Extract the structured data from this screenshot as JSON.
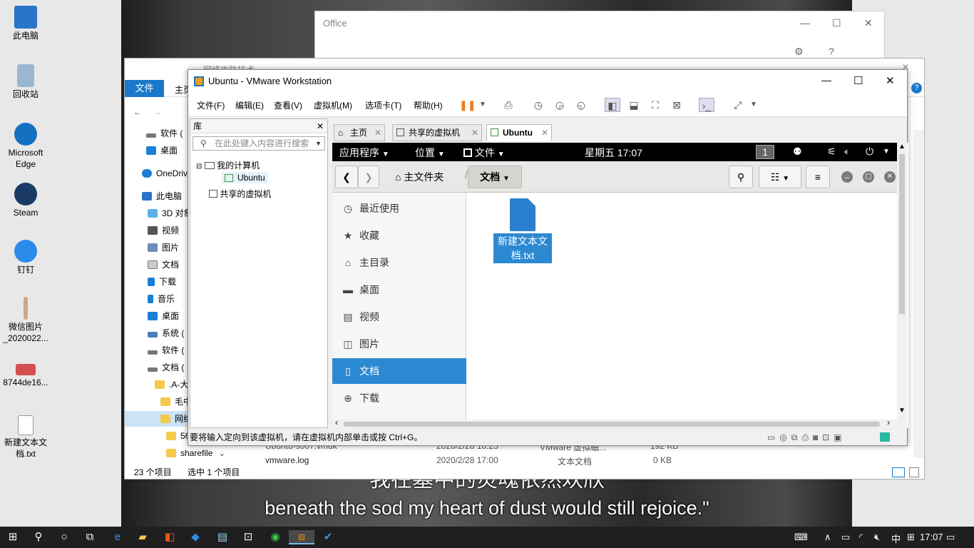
{
  "desktop": {
    "icons": [
      {
        "label": "此电脑",
        "icon": "computer-icon",
        "color": "#2a74c9"
      },
      {
        "label": "回收站",
        "icon": "recycle-bin-icon",
        "color": "#9bb7d0"
      },
      {
        "label": "Microsoft Edge",
        "icon": "edge-icon",
        "color": "#1570c2"
      },
      {
        "label": "Steam",
        "icon": "steam-icon",
        "color": "#1b3a66"
      },
      {
        "label": "钉钉",
        "icon": "dingtalk-icon",
        "color": "#2a8be8"
      },
      {
        "label": "微信图片_2020022...",
        "icon": "image-icon",
        "color": "#c9a88a"
      },
      {
        "label": "8744de16...",
        "icon": "image-icon",
        "color": "#d35050"
      },
      {
        "label": "新建文本文档.txt",
        "icon": "text-file-icon",
        "color": "#ffffff"
      }
    ],
    "subtitle_cn": "我在墓中的灵魂依然欢欣",
    "subtitle_en": "beneath the sod my heart of dust would still rejoice.\""
  },
  "office": {
    "title": "Office"
  },
  "explorer": {
    "title": "网络攻防技术",
    "ribbon_file": "文件",
    "ribbon_home": "主页",
    "sidebar": [
      {
        "label": "软件 (",
        "icon": "drive-icon"
      },
      {
        "label": "桌面",
        "icon": "desktop-folder-icon"
      },
      {
        "label": "OneDriv",
        "icon": "onedrive-icon"
      },
      {
        "label": "此电脑",
        "icon": "computer-icon"
      },
      {
        "label": "3D 对象",
        "icon": "3d-objects-icon"
      },
      {
        "label": "视频",
        "icon": "video-folder-icon"
      },
      {
        "label": "图片",
        "icon": "pictures-folder-icon"
      },
      {
        "label": "文档",
        "icon": "documents-folder-icon"
      },
      {
        "label": "下载",
        "icon": "download-icon"
      },
      {
        "label": "音乐",
        "icon": "music-icon"
      },
      {
        "label": "桌面",
        "icon": "desktop-folder-icon"
      },
      {
        "label": "系统 (",
        "icon": "drive-icon"
      },
      {
        "label": "软件 (",
        "icon": "drive-icon"
      },
      {
        "label": "文档 (",
        "icon": "drive-icon"
      },
      {
        "label": ".A-大",
        "icon": "folder-icon"
      },
      {
        "label": "毛中",
        "icon": "folder-icon"
      },
      {
        "label": "网络",
        "icon": "folder-icon"
      },
      {
        "label": "56",
        "icon": "folder-icon"
      },
      {
        "label": "sharefile",
        "icon": "folder-icon"
      }
    ],
    "files": [
      {
        "name": "Ubuntu-s007.vmdk",
        "date": "2020/2/28 16:23",
        "type": "VMware 虚拟磁...",
        "size": "192 KB"
      },
      {
        "name": "vmware.log",
        "date": "2020/2/28 17:00",
        "type": "文本文档",
        "size": "0 KB"
      }
    ],
    "status_count": "23 个项目",
    "status_selected": "选中 1 个项目"
  },
  "vmware": {
    "title": "Ubuntu - VMware Workstation",
    "menu": [
      "文件(F)",
      "编辑(E)",
      "查看(V)",
      "虚拟机(M)",
      "选项卡(T)",
      "帮助(H)"
    ],
    "library": {
      "header": "库",
      "search_placeholder": "在此处键入内容进行搜索",
      "my_computer": "我的计算机",
      "vm_ubuntu": "Ubuntu",
      "shared_vms": "共享的虚拟机"
    },
    "tabs": [
      {
        "label": "主页",
        "icon": "home-icon"
      },
      {
        "label": "共享的虚拟机",
        "icon": "vm-icon"
      },
      {
        "label": "Ubuntu",
        "icon": "vm-icon",
        "active": true
      }
    ],
    "status_text": "要将输入定向到该虚拟机，请在虚拟机内部单击或按 Ctrl+G。"
  },
  "ubuntu": {
    "topbar": {
      "applications": "应用程序",
      "places": "位置",
      "files_app": "文件",
      "clock": "星期五 17:07",
      "workspace": "1"
    },
    "header": {
      "home_folder": "主文件夹",
      "current_folder": "文档"
    },
    "places": [
      {
        "label": "最近使用",
        "icon": "clock-icon"
      },
      {
        "label": "收藏",
        "icon": "star-icon"
      },
      {
        "label": "主目录",
        "icon": "home-icon"
      },
      {
        "label": "桌面",
        "icon": "desktop-folder-icon"
      },
      {
        "label": "视频",
        "icon": "video-icon"
      },
      {
        "label": "图片",
        "icon": "pictures-icon"
      },
      {
        "label": "文档",
        "icon": "document-icon",
        "selected": true
      },
      {
        "label": "下载",
        "icon": "download-icon"
      }
    ],
    "file": {
      "name": "新建文本文档.txt"
    }
  },
  "taskbar": {
    "time": "17:07",
    "ime": "中"
  }
}
